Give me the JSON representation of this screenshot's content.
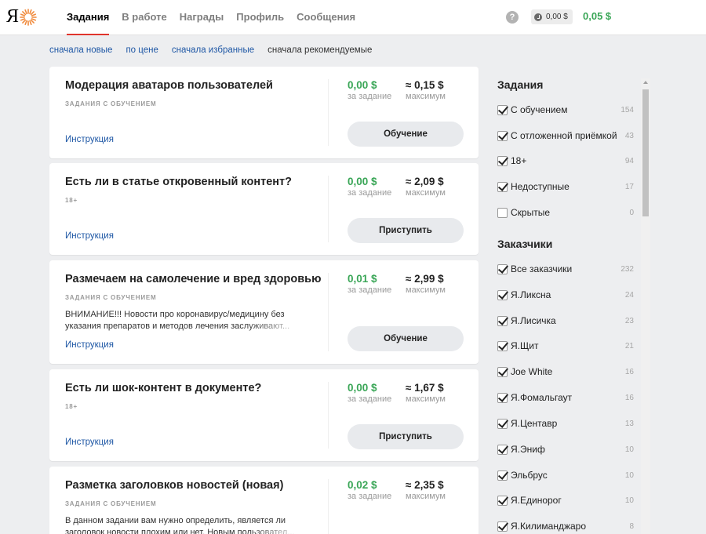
{
  "header": {
    "logo_text": "Я",
    "nav": [
      {
        "label": "Задания",
        "active": true
      },
      {
        "label": "В работе",
        "active": false
      },
      {
        "label": "Награды",
        "active": false
      },
      {
        "label": "Профиль",
        "active": false
      },
      {
        "label": "Сообщения",
        "active": false
      }
    ],
    "help_symbol": "?",
    "pending_balance": "0,00 $",
    "earned_balance": "0,05 $"
  },
  "sort": {
    "items": [
      "сначала новые",
      "по цене",
      "сначала избранные",
      "сначала рекомендуемые"
    ],
    "current_index": 3
  },
  "tasks": [
    {
      "title": "Модерация аватаров пользователей",
      "tag": "задания с обучением",
      "description": "",
      "link": "Инструкция",
      "price": "0,00 $",
      "price_caption": "за задание",
      "max": "≈ 0,15 $",
      "max_caption": "максимум",
      "button": "Обучение"
    },
    {
      "title": "Есть ли в статье откровенный контент?",
      "tag": "18+",
      "description": "",
      "link": "Инструкция",
      "price": "0,00 $",
      "price_caption": "за задание",
      "max": "≈ 2,09 $",
      "max_caption": "максимум",
      "button": "Приступить"
    },
    {
      "title": "Размечаем на самолечение и вред здоровью",
      "tag": "задания с обучением",
      "description": "ВНИМАНИЕ!!! Новости про коронавирус/медицину без указания препаратов и методов лечения заслуживают...",
      "link": "Инструкция",
      "price": "0,01 $",
      "price_caption": "за задание",
      "max": "≈ 2,99 $",
      "max_caption": "максимум",
      "button": "Обучение"
    },
    {
      "title": "Есть ли шок-контент в документе?",
      "tag": "18+",
      "description": "",
      "link": "Инструкция",
      "price": "0,00 $",
      "price_caption": "за задание",
      "max": "≈ 1,67 $",
      "max_caption": "максимум",
      "button": "Приступить"
    },
    {
      "title": "Разметка заголовков новостей (новая)",
      "tag": "задания с обучением",
      "description": "В данном задании вам нужно определить, является ли заголовок новости плохим или нет. Новым пользовател...",
      "link": "Инструкция",
      "price": "0,02 $",
      "price_caption": "за задание",
      "max": "≈ 2,35 $",
      "max_caption": "максимум",
      "button": "Обучение"
    }
  ],
  "sidebar": {
    "tasks_heading": "Задания",
    "task_filters": [
      {
        "label": "С обучением",
        "count": "154",
        "checked": true
      },
      {
        "label": "С отложенной приёмкой",
        "count": "43",
        "checked": true
      },
      {
        "label": "18+",
        "count": "94",
        "checked": true
      },
      {
        "label": "Недоступные",
        "count": "17",
        "checked": true
      },
      {
        "label": "Скрытые",
        "count": "0",
        "checked": false
      }
    ],
    "customers_heading": "Заказчики",
    "customer_filters": [
      {
        "label": "Все заказчики",
        "count": "232",
        "checked": true
      },
      {
        "label": "Я.Ликсна",
        "count": "24",
        "checked": true
      },
      {
        "label": "Я.Лисичка",
        "count": "23",
        "checked": true
      },
      {
        "label": "Я.Щит",
        "count": "21",
        "checked": true
      },
      {
        "label": "Joe White",
        "count": "16",
        "checked": true
      },
      {
        "label": "Я.Фомальгаут",
        "count": "16",
        "checked": true
      },
      {
        "label": "Я.Центавр",
        "count": "13",
        "checked": true
      },
      {
        "label": "Я.Эниф",
        "count": "10",
        "checked": true
      },
      {
        "label": "Эльбрус",
        "count": "10",
        "checked": true
      },
      {
        "label": "Я.Единорог",
        "count": "10",
        "checked": true
      },
      {
        "label": "Я.Килиманджаро",
        "count": "8",
        "checked": true
      }
    ]
  },
  "colors": {
    "accent_red": "#e0342c",
    "price_green": "#3aa657",
    "link_blue": "#1e57a5"
  }
}
